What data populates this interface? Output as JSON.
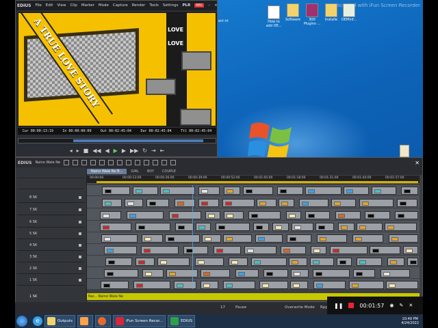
{
  "player": {
    "menu": [
      "EDIUS",
      "File",
      "Edit",
      "View",
      "Clip",
      "Marker",
      "Mode",
      "Capture",
      "Render",
      "Tools",
      "Settings"
    ],
    "badge_plr": "PLR",
    "badge_rec": "REC",
    "video_text": "A TRUE LOVE STORY",
    "love1": "LOVE",
    "love2": "LOVE",
    "timecode": {
      "cur": "Cur 00:00:13:19",
      "in": "In 00:00:00:00",
      "out": "Out 00:02:45:04",
      "dur": "Dur 00:02:45:04",
      "ttl": "Ttl 00:02:45:04"
    }
  },
  "timeline": {
    "logo": "EDIUS",
    "project": "Naino Wale Ne",
    "tabs": [
      "Naino Wale Ne B...",
      "GIRL",
      "BOY",
      "COUPLE"
    ],
    "ruler": [
      "00:00:00",
      "00:00:13:00",
      "00:00:26:00",
      "00:00:39:00",
      "00:00:52:00",
      "00:01:05:00",
      "00:01:18:00",
      "00:01:31:00",
      "00:01:44:00",
      "00:01:57:00"
    ],
    "tracks": [
      "8 SK",
      "7 SK",
      "6 SK",
      "5 SK",
      "4 SK",
      "3 SK",
      "2 SK",
      "1 SK"
    ],
    "title_track_label": "1 SK",
    "title_clip": "Nai...  Naino Wale Ne"
  },
  "status": {
    "count": "17",
    "pause": "Pause",
    "mode": "Overwrite Mode",
    "rpp": "Rpp"
  },
  "recorder": {
    "time": "00:01:57"
  },
  "desktop": {
    "watermark": "Recorded with iFun Screen Recorder",
    "icons": [
      {
        "label": "How to add OE..."
      },
      {
        "label": "Software"
      },
      {
        "label": "300 Plugins ..."
      },
      {
        "label": "Installe"
      },
      {
        "label": "OEMinf..."
      }
    ],
    "edge_label": "ect nt"
  },
  "taskbar": {
    "items": [
      "Outputs",
      "iFun Screen Recor...",
      "EDIUS"
    ],
    "time": "10:49 PM",
    "date": "4/24/2022"
  },
  "colors": {
    "accent": "#d8b200",
    "rec": "#e22233",
    "video_bg": "#f4c000"
  }
}
